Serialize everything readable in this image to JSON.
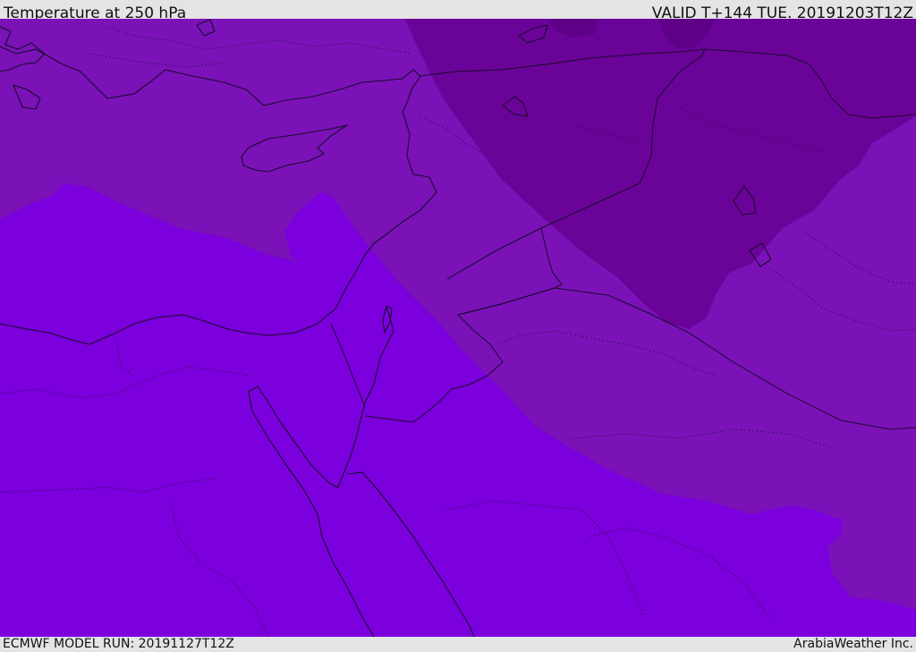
{
  "header": {
    "title": "Temperature at 250 hPa",
    "valid": "VALID T+144 TUE. 20191203T12Z"
  },
  "footer": {
    "model_run": "ECMWF MODEL RUN: 20191127T12Z",
    "credit": "ArabiaWeather Inc."
  },
  "colors": {
    "warmest": "#7b00dd",
    "mid": "#7a12b8",
    "cold": "#6a0498",
    "coldest": "#5e0088",
    "background_bar": "#e4e4e4",
    "coastline": "#1a0a2a"
  }
}
